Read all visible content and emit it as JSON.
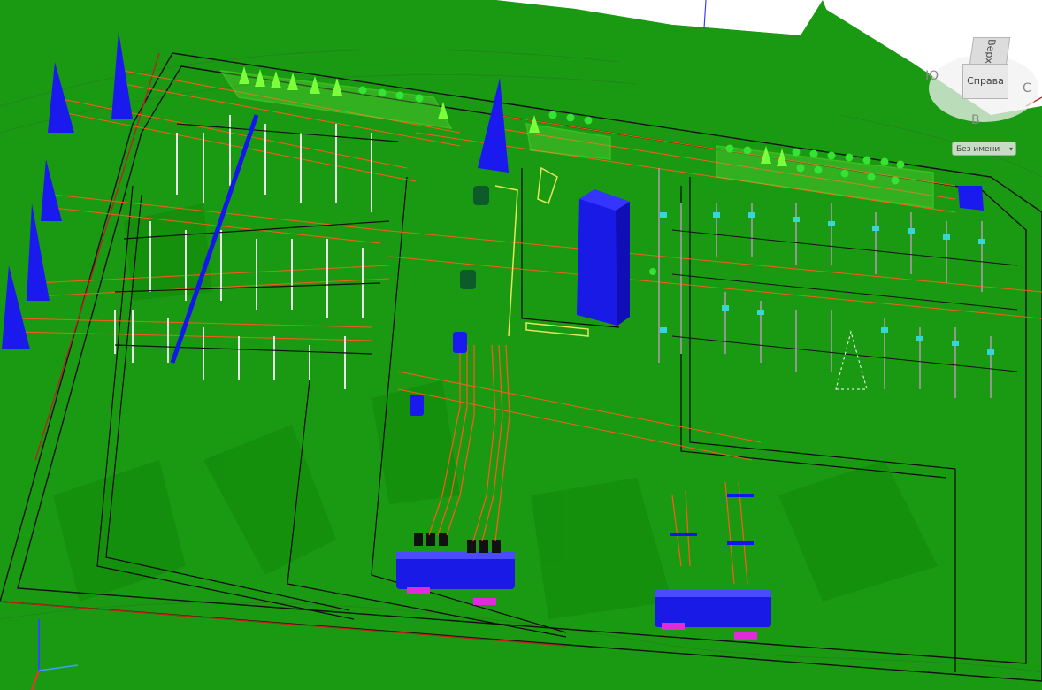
{
  "view_cube": {
    "front_label": "Справа",
    "top_label": "Верх",
    "compass": {
      "west": "Ю",
      "east": "С",
      "south": "В"
    }
  },
  "named_view": {
    "label": "Без имени",
    "chevron": "▾"
  },
  "colors": {
    "terrain": "#1a9a12",
    "terrain_dark": "#128a0c",
    "outer_fill": "#ffffff",
    "structures_blue": "#1515ee",
    "cable_red": "#ff4a10",
    "fence_black": "#111111",
    "equipment_light_green": "#7cff3b",
    "yellow_outline": "#e7e65a",
    "cyan": "#35d6d6",
    "magenta": "#e12bd8"
  },
  "icons": [
    "ucs-axis-icon",
    "north-compass-icon",
    "chevron-down-icon"
  ]
}
